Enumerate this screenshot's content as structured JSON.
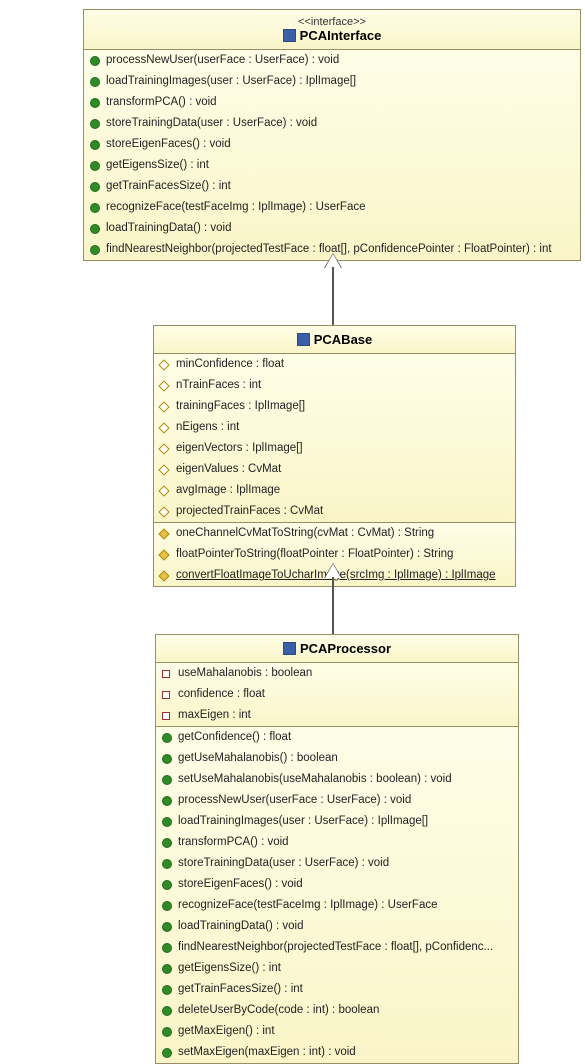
{
  "interface": {
    "stereotype": "<<interface>>",
    "name": "PCAInterface",
    "methods": [
      "processNewUser(userFace : UserFace) : void",
      "loadTrainingImages(user : UserFace) : IplImage[]",
      "transformPCA() : void",
      "storeTrainingData(user : UserFace) : void",
      "storeEigenFaces() : void",
      "getEigensSize() : int",
      "getTrainFacesSize() : int",
      "recognizeFace(testFaceImg : IplImage) : UserFace",
      "loadTrainingData() : void",
      "findNearestNeighbor(projectedTestFace : float[], pConfidencePointer : FloatPointer) : int"
    ]
  },
  "base": {
    "name": "PCABase",
    "attrs": [
      "minConfidence : float",
      "nTrainFaces : int",
      "trainingFaces : IplImage[]",
      "nEigens : int",
      "eigenVectors : IplImage[]",
      "eigenValues : CvMat",
      "avgImage : IplImage",
      "projectedTrainFaces : CvMat"
    ],
    "methods": [
      {
        "text": "oneChannelCvMatToString(cvMat : CvMat) : String",
        "u": false
      },
      {
        "text": "floatPointerToString(floatPointer : FloatPointer) : String",
        "u": false
      },
      {
        "text": "convertFloatImageToUcharImage(srcImg : IplImage) : IplImage",
        "u": true
      }
    ]
  },
  "processor": {
    "name": "PCAProcessor",
    "attrs": [
      "useMahalanobis : boolean",
      "confidence : float",
      "maxEigen : int"
    ],
    "methods": [
      "getConfidence() : float",
      "getUseMahalanobis() : boolean",
      "setUseMahalanobis(useMahalanobis : boolean) : void",
      "processNewUser(userFace : UserFace) : void",
      "loadTrainingImages(user : UserFace) : IplImage[]",
      "transformPCA() : void",
      "storeTrainingData(user : UserFace) : void",
      "storeEigenFaces() : void",
      "recognizeFace(testFaceImg : IplImage) : UserFace",
      "loadTrainingData() : void",
      "findNearestNeighbor(projectedTestFace : float[], pConfidenc...",
      "getEigensSize() : int",
      "getTrainFacesSize() : int",
      "deleteUserByCode(code : int) : boolean",
      "getMaxEigen() : int",
      "setMaxEigen(maxEigen : int) : void"
    ]
  }
}
